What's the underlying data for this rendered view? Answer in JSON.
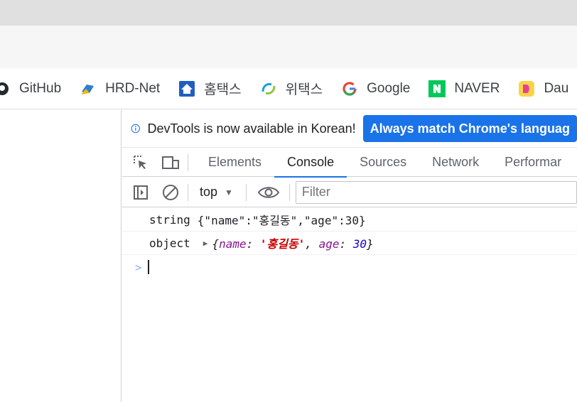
{
  "bookmarks": [
    {
      "icon": "github-icon",
      "label": "GitHub"
    },
    {
      "icon": "hrd-net-icon",
      "label": "HRD-Net"
    },
    {
      "icon": "hometax-icon",
      "label": "홈택스"
    },
    {
      "icon": "wetax-icon",
      "label": "위택스"
    },
    {
      "icon": "google-icon",
      "label": "Google"
    },
    {
      "icon": "naver-icon",
      "label": "NAVER"
    },
    {
      "icon": "daum-icon",
      "label": "Dau"
    }
  ],
  "devtools": {
    "infobar": {
      "message": "DevTools is now available in Korean!",
      "button_label": "Always match Chrome's languag"
    },
    "tabs": [
      "Elements",
      "Console",
      "Sources",
      "Network",
      "Performar"
    ],
    "active_tab": "Console",
    "console_toolbar": {
      "context": "top",
      "filter_placeholder": "Filter"
    },
    "logs": {
      "line1": {
        "type_label": "string",
        "value": "{\"name\":\"홍길동\",\"age\":30}"
      },
      "line2": {
        "type_label": "object",
        "open_brace": "{",
        "key1": "name",
        "value1": "'홍길동'",
        "key2": "age",
        "value2": "30",
        "close_brace": "}"
      }
    },
    "prompt_symbol": ">"
  },
  "colors": {
    "accent": "#1a73e8",
    "string_value": "#c80000",
    "number_value": "#1c00cf",
    "property_key": "#881391"
  }
}
